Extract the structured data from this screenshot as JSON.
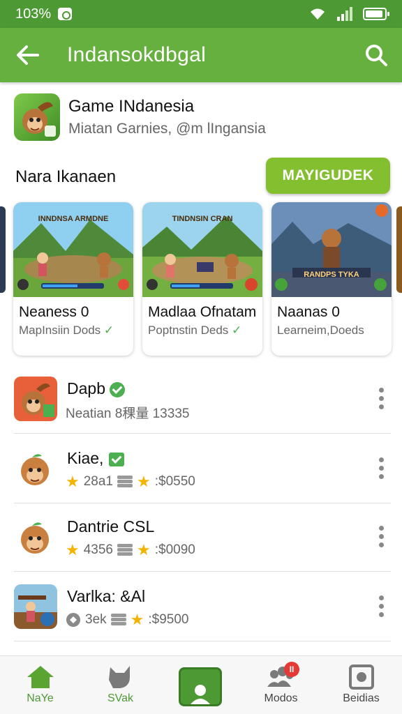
{
  "status_bar": {
    "battery_text": "103%"
  },
  "app_bar": {
    "title": "Indansokdbgal"
  },
  "header": {
    "title": "Game INdanesia",
    "subtitle": "Miatan Garnies, @m lIngansia"
  },
  "section": {
    "title": "Nara Ikanaen",
    "button_label": "MAYIGUDEK"
  },
  "cards": [
    {
      "name": "Neaness 0",
      "sub": "MapInsiin Dods",
      "verified": true,
      "thumb_title": "INNDNSA ARMDNE"
    },
    {
      "name": "Madlaa Ofnatam",
      "sub": "Poptnstin Deds",
      "verified": true,
      "thumb_title": "TINDNSIN CRAN"
    },
    {
      "name": "Naanas 0",
      "sub": "Learneim,Doeds",
      "verified": false,
      "thumb_title": "RANDPS TYKA"
    }
  ],
  "list": [
    {
      "name": "Dapb",
      "meta": "Neatian 8稞量 13335",
      "badge": "check"
    },
    {
      "name": "Kiae,",
      "rating": "28a1",
      "price": ":$0550",
      "badge": "square"
    },
    {
      "name": "Dantrie CSL",
      "rating": "4356",
      "price": ":$0090",
      "badge": ""
    },
    {
      "name": "Varlka: &Al",
      "rating": "3ek",
      "price": ":$9500",
      "badge": ""
    }
  ],
  "bottom_nav": [
    {
      "label": "NaYe",
      "icon": "home-icon",
      "active": true
    },
    {
      "label": "SVak",
      "icon": "cat-icon",
      "active": true
    },
    {
      "label": "",
      "icon": "profile-icon",
      "active": true
    },
    {
      "label": "Modos",
      "icon": "group-icon",
      "badge": "II"
    },
    {
      "label": "Beidias",
      "icon": "media-icon"
    }
  ],
  "colors": {
    "primary": "#66b040",
    "status": "#4d9a34",
    "button": "#84bf2f",
    "star": "#f2b400"
  }
}
